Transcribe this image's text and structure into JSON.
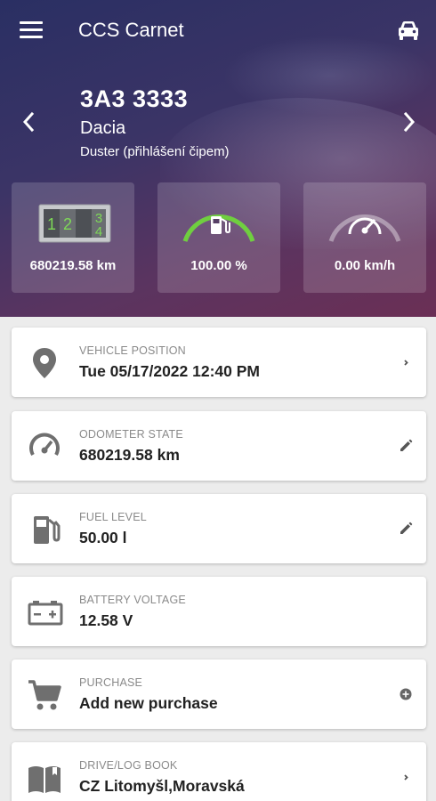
{
  "appbar": {
    "title": "CCS Carnet",
    "menu_icon": "hamburger-menu-icon",
    "vehicle_icon": "car-icon"
  },
  "vehicle": {
    "plate": "3A3 3333",
    "make": "Dacia",
    "model": "Duster (přihlášení čipem)"
  },
  "tiles": [
    {
      "icon": "odometer-digits-icon",
      "value": "680219.58 km",
      "digits": [
        "1",
        "2",
        "3",
        "4"
      ]
    },
    {
      "icon": "fuel-gauge-icon",
      "value": "100.00 %",
      "fill_fraction": 1.0
    },
    {
      "icon": "speedometer-gauge-icon",
      "value": "0.00 km/h",
      "fill_fraction": 0.0
    }
  ],
  "cards": [
    {
      "label": "VEHICLE POSITION",
      "value": "Tue 05/17/2022 12:40 PM",
      "icon": "location-pin-icon",
      "action": "chevron-right-icon"
    },
    {
      "label": "ODOMETER STATE",
      "value": "680219.58 km",
      "icon": "speedometer-icon",
      "action": "edit-pencil-icon"
    },
    {
      "label": "FUEL LEVEL",
      "value": "50.00 l",
      "icon": "fuel-pump-icon",
      "action": "edit-pencil-icon"
    },
    {
      "label": "BATTERY VOLTAGE",
      "value": "12.58 V",
      "icon": "battery-icon",
      "action": null
    },
    {
      "label": "PURCHASE",
      "value": "Add new purchase",
      "icon": "shopping-cart-icon",
      "action": "add-circle-icon"
    },
    {
      "label": "DRIVE/LOG BOOK",
      "value": "CZ Litomyšl,Moravská",
      "icon": "book-icon",
      "action": "chevron-right-icon"
    }
  ],
  "colors": {
    "header_start": "#2a2f63",
    "header_end": "#6b2f55",
    "gauge_green": "#6fcf3f",
    "digit_green": "#7ed957",
    "icon_gray": "#6f6f6f"
  }
}
